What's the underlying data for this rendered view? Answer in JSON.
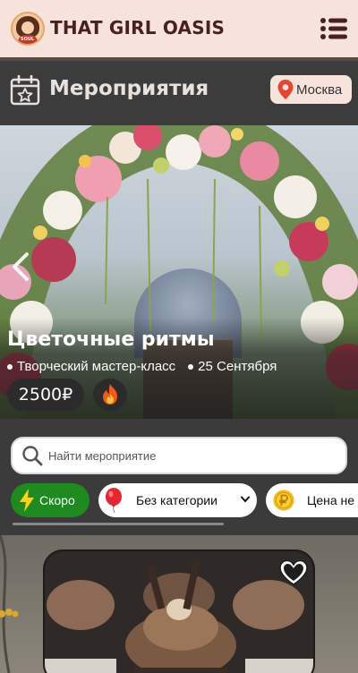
{
  "header": {
    "brand": "THAT GIRL OASIS",
    "logo_text": "SOUL",
    "menu_icon": "list-icon"
  },
  "section": {
    "title": "Мероприятия",
    "icon": "calendar-star-icon",
    "city": "Москва",
    "city_icon": "map-pin-icon"
  },
  "hero": {
    "title": "Цветочные ритмы",
    "category": "Творческий мастер-класс",
    "date": "25 Сентября",
    "price": "2500₽",
    "hot_icon": "fire-icon",
    "prev_icon": "chevron-left-icon"
  },
  "search": {
    "placeholder": "Найти мероприятие",
    "icon": "search-icon"
  },
  "filters": {
    "soon": "Скоро",
    "category": "Без категории",
    "price": "Цена не"
  },
  "feed": {
    "fav_icon": "heart-icon"
  },
  "colors": {
    "header_bg": "#f6e4dc",
    "brand_text": "#4a1f1f",
    "dark_bg": "#3b3b3b",
    "soon_chip": "#1f8a20"
  }
}
